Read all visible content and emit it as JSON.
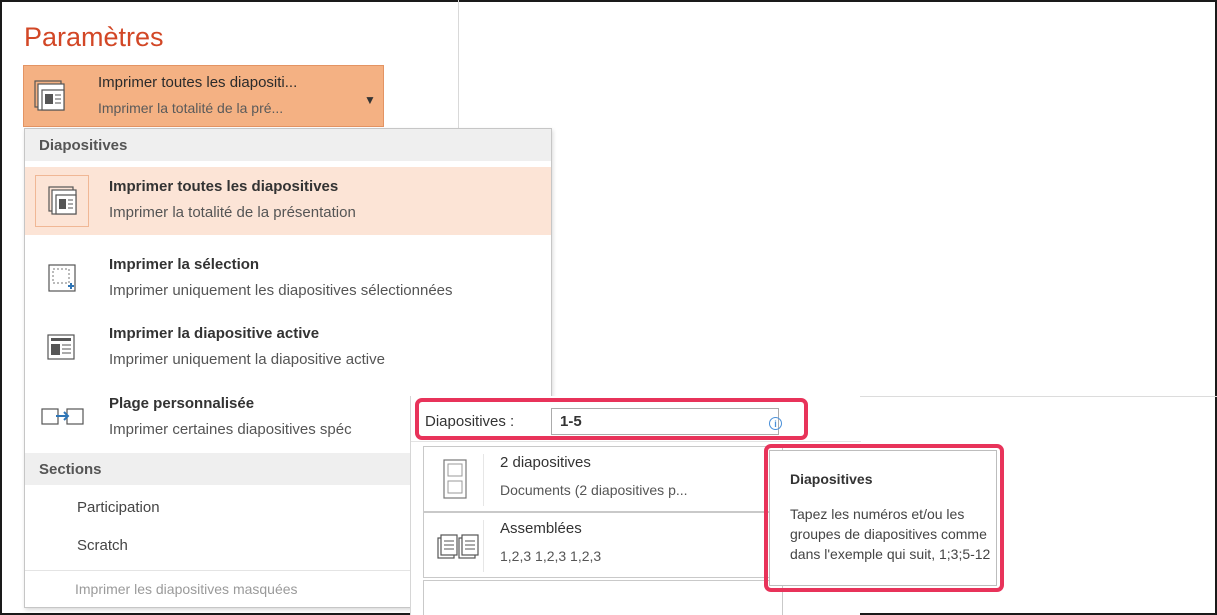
{
  "settings": {
    "title": "Paramètres",
    "print_select": {
      "line1": "Imprimer toutes les diapositi...",
      "line2": "Imprimer la totalité de la pré...",
      "icon": "slides-stack-icon"
    }
  },
  "menu": {
    "slides_header": "Diapositives",
    "items": [
      {
        "title": "Imprimer toutes les diapositives",
        "subtitle": "Imprimer la totalité de la présentation",
        "icon": "all-slides-icon"
      },
      {
        "title": "Imprimer la sélection",
        "subtitle": "Imprimer uniquement les diapositives sélectionnées",
        "icon": "selection-icon"
      },
      {
        "title": "Imprimer la diapositive active",
        "subtitle": "Imprimer uniquement la diapositive active",
        "icon": "current-slide-icon"
      },
      {
        "title": "Plage personnalisée",
        "subtitle": "Imprimer certaines diapositives spéc",
        "icon": "custom-range-icon"
      }
    ],
    "sections_header": "Sections",
    "sections": [
      "Participation",
      "Scratch"
    ],
    "hidden_slides": "Imprimer les diapositives masquées"
  },
  "range": {
    "label": "Diapositives :",
    "value": "1-5",
    "info_icon": "i"
  },
  "layout_option": {
    "title": "2 diapositives",
    "subtitle": "Documents (2 diapositives p..."
  },
  "collate_option": {
    "title": "Assemblées",
    "subtitle": "1,2,3   1,2,3   1,2,3"
  },
  "tooltip": {
    "title": "Diapositives",
    "body": "Tapez les numéros et/ou les groupes de diapositives comme dans l'exemple qui suit, 1;3;5-12"
  },
  "colors": {
    "accent": "#d24726",
    "selected_bg": "#f4b183",
    "highlight": "#e8335a"
  }
}
